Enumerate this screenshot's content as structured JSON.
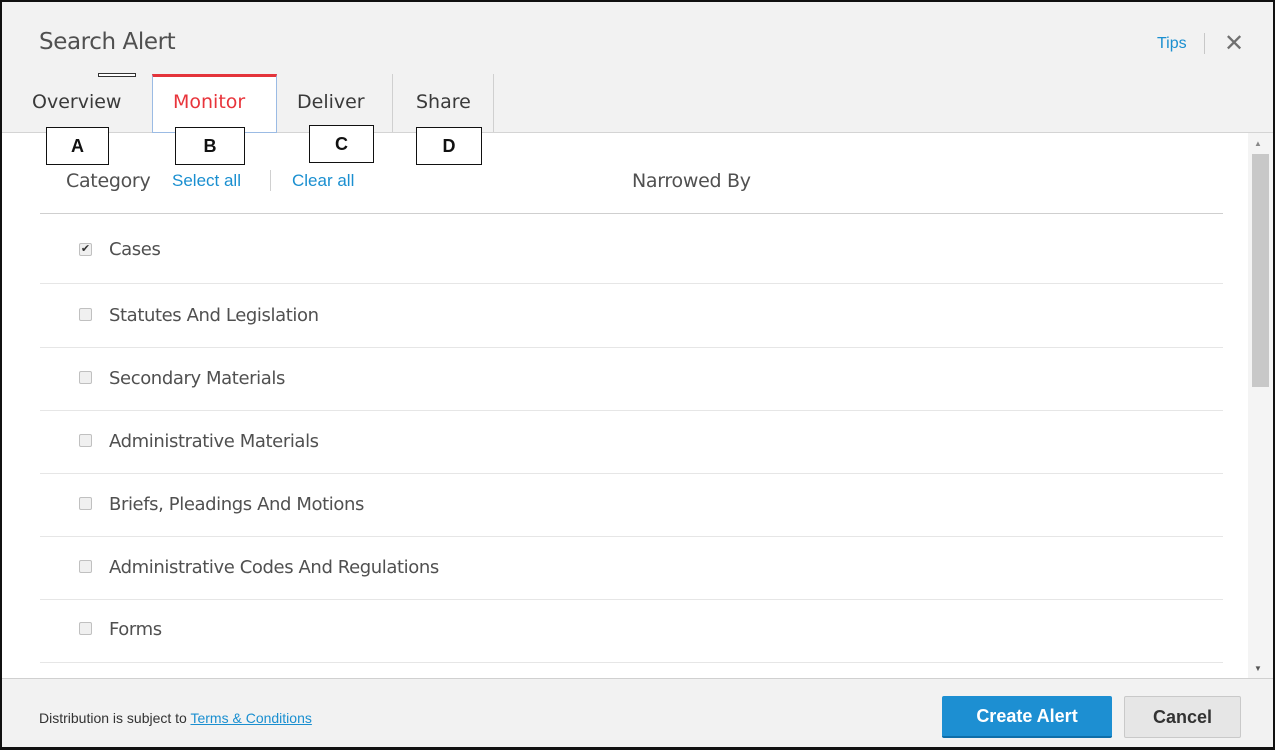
{
  "header": {
    "title": "Search Alert",
    "tips_label": "Tips",
    "close_glyph": "✕"
  },
  "tabs": [
    {
      "label": "Overview",
      "active": false
    },
    {
      "label": "Monitor",
      "active": true
    },
    {
      "label": "Deliver",
      "active": false
    },
    {
      "label": "Share",
      "active": false
    }
  ],
  "annotations": [
    "A",
    "B",
    "C",
    "D"
  ],
  "filter": {
    "category_label": "Category",
    "select_all_label": "Select all",
    "clear_all_label": "Clear all",
    "narrowed_by_label": "Narrowed By"
  },
  "categories": [
    {
      "label": "Cases",
      "checked": true
    },
    {
      "label": "Statutes And Legislation",
      "checked": false
    },
    {
      "label": "Secondary Materials",
      "checked": false
    },
    {
      "label": "Administrative Materials",
      "checked": false
    },
    {
      "label": "Briefs, Pleadings And Motions",
      "checked": false
    },
    {
      "label": "Administrative Codes And Regulations",
      "checked": false
    },
    {
      "label": "Forms",
      "checked": false
    }
  ],
  "footer": {
    "distribution_text": "Distribution is subject to ",
    "terms_link": "Terms & Conditions",
    "create_button": "Create Alert",
    "cancel_button": "Cancel"
  },
  "colors": {
    "accent": "#1d8fd2",
    "active_tab": "#e8343b"
  },
  "icons": {
    "close": "close-icon",
    "checkmark": "checkmark-icon",
    "scroll_up": "scroll-up-arrow-icon",
    "scroll_down": "scroll-down-arrow-icon"
  }
}
